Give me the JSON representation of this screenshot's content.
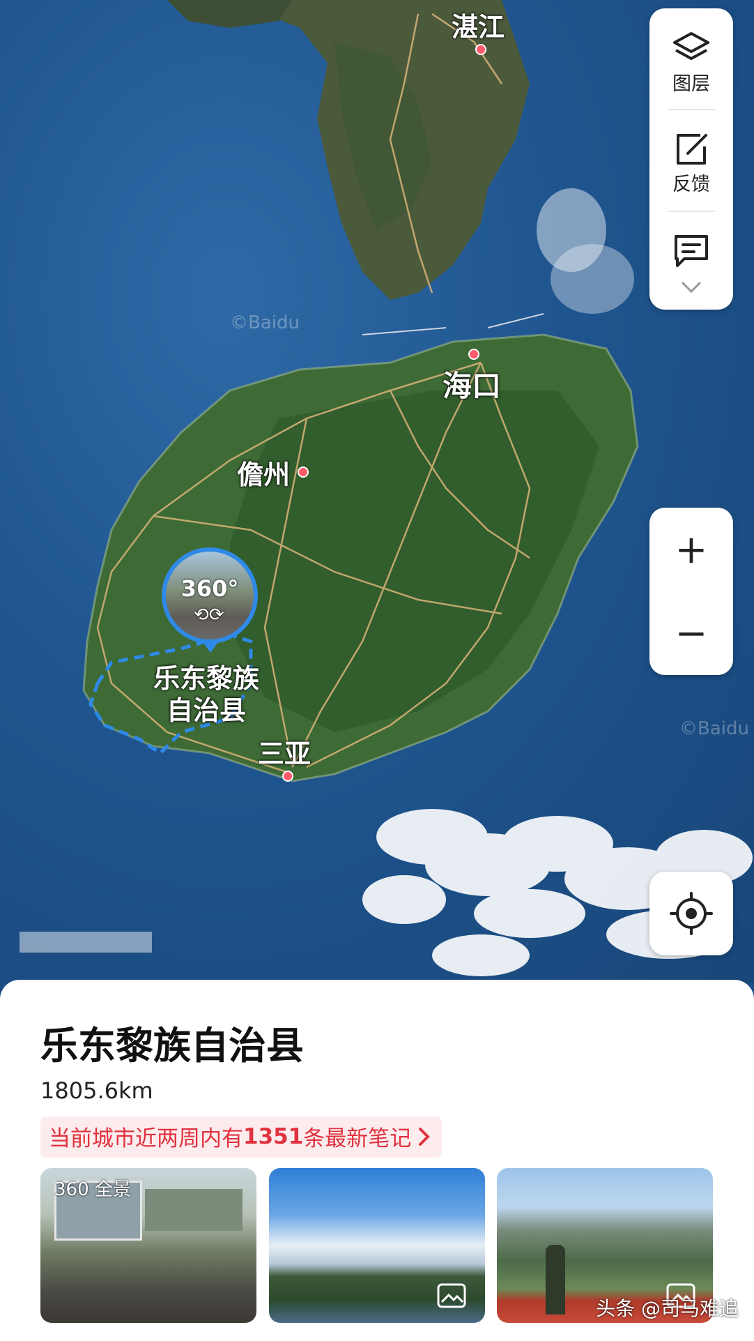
{
  "map": {
    "cities": [
      {
        "name": "湛江"
      },
      {
        "name": "海口"
      },
      {
        "name": "儋州"
      },
      {
        "name": "三亚"
      }
    ],
    "district": {
      "name_line1": "乐东黎族",
      "name_line2": "自治县"
    },
    "panorama_badge": "360°",
    "baidu_watermark": "©Baidu"
  },
  "toolbar": {
    "layers_label": "图层",
    "feedback_label": "反馈"
  },
  "zoom": {
    "in": "+",
    "out": "−"
  },
  "sheet": {
    "title": "乐东黎族自治县",
    "distance": "1805.6km",
    "notes_prefix": "当前城市近两周内有",
    "notes_count": "1351",
    "notes_suffix": "条最新笔记",
    "photo1_badge": "360 全景"
  },
  "watermark": "头条 @司马难追",
  "colors": {
    "accent": "#e0323f",
    "route": "#2e8ae6"
  }
}
